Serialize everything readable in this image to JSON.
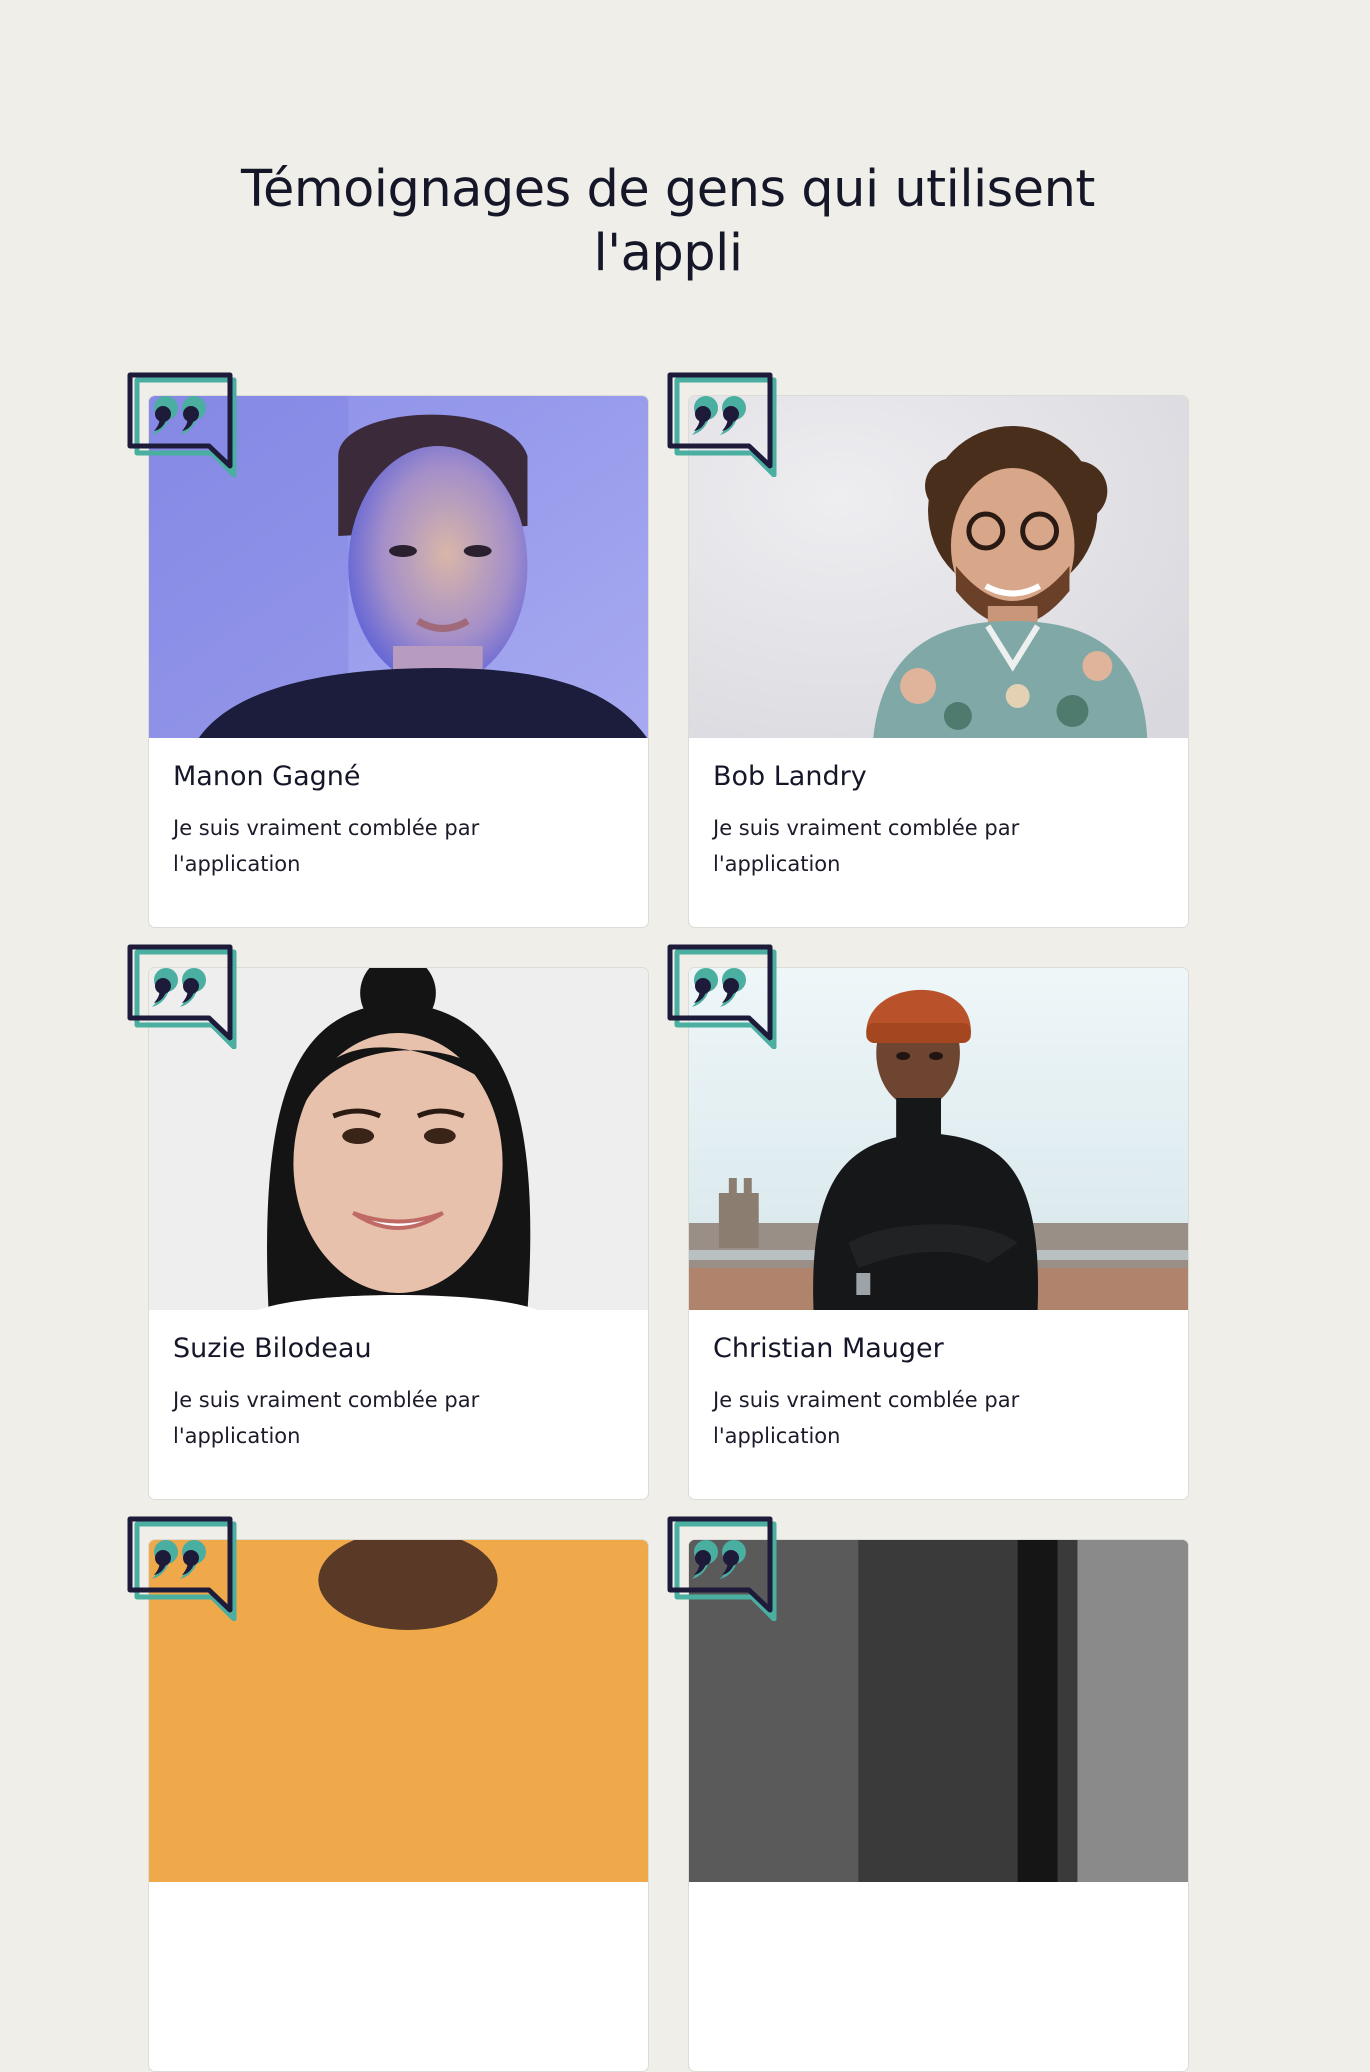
{
  "page": {
    "title": "Témoignages de gens qui utilisent l'appli"
  },
  "colors": {
    "background": "#efeee9",
    "bubble_dark": "#1e1a3a",
    "bubble_teal": "#4aaea0",
    "card": "#ffffff"
  },
  "testimonials": [
    {
      "name": "Manon Gagné",
      "text": "Je suis vraiment comblée par l'application",
      "photo": "woman-portrait-blue-light"
    },
    {
      "name": "Bob Landry",
      "text": "Je suis vraiment comblée par l'application",
      "photo": "man-curly-hair-glasses"
    },
    {
      "name": "Suzie Bilodeau",
      "text": "Je suis vraiment comblée par l'application",
      "photo": "woman-smiling-dark-hair"
    },
    {
      "name": "Christian Mauger",
      "text": "Je suis vraiment comblée par l'application",
      "photo": "man-orange-beanie-city"
    },
    {
      "name": "",
      "text": "",
      "photo": "portrait-orange-background"
    },
    {
      "name": "",
      "text": "",
      "photo": "portrait-dark-background"
    }
  ],
  "icons": {
    "quote_bubble": "quote-bubble-icon"
  }
}
